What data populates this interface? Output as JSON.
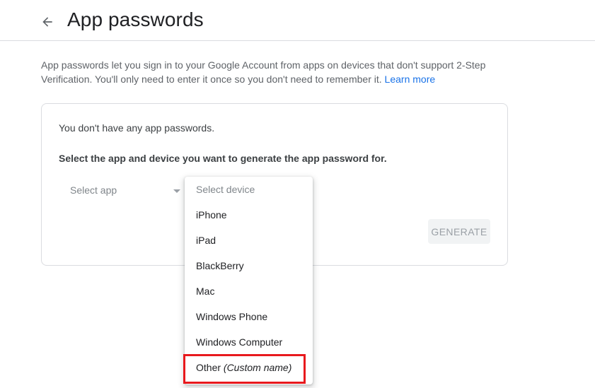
{
  "header": {
    "title": "App passwords",
    "back_icon": "arrow-back-icon"
  },
  "intro": {
    "text": "App passwords let you sign in to your Google Account from apps on devices that don't support 2-Step Verification. You'll only need to enter it once so you don't need to remember it.",
    "link_text": "Learn more"
  },
  "card": {
    "empty_message": "You don't have any app passwords.",
    "instructions": "Select the app and device you want to generate the app password for.",
    "select_app": {
      "value": "Select app"
    },
    "generate_label": "GENERATE"
  },
  "device_dropdown": {
    "placeholder": "Select device",
    "options": [
      "iPhone",
      "iPad",
      "BlackBerry",
      "Mac",
      "Windows Phone",
      "Windows Computer"
    ],
    "other": {
      "label": "Other",
      "hint": "(Custom name)"
    }
  },
  "colors": {
    "link": "#1a73e8",
    "highlight": "#e8191d",
    "border": "#dadce0"
  }
}
